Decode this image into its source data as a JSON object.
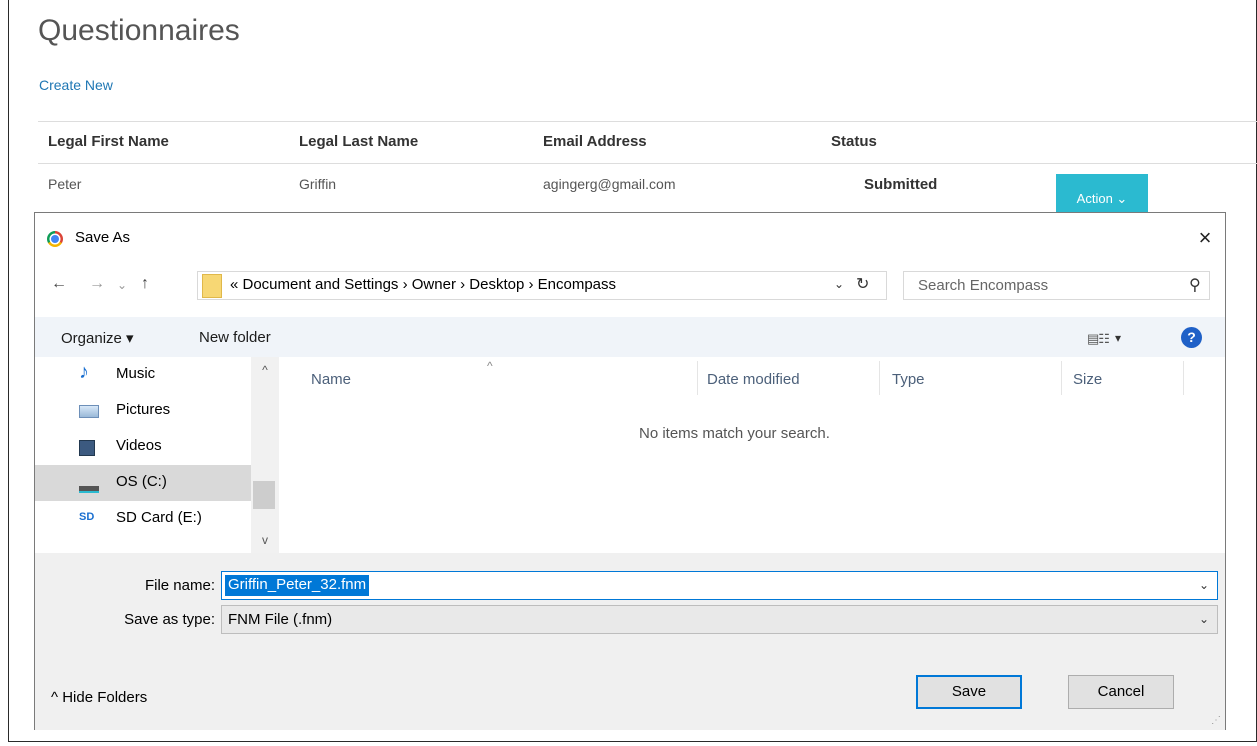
{
  "page": {
    "title": "Questionnaires",
    "create_link": "Create New",
    "table": {
      "headers": [
        "Legal First Name",
        "Legal Last Name",
        "Email Address",
        "Status"
      ],
      "rows": [
        {
          "first": "Peter",
          "last": "Griffin",
          "email": "agingerg@gmail.com",
          "status": "Submitted",
          "action": "Action ⌄"
        }
      ]
    }
  },
  "dialog": {
    "title": "Save As",
    "close_icon": "×",
    "nav": {
      "back": "←",
      "forward": "→",
      "recent": "⌄",
      "up": "↑"
    },
    "address": {
      "breadcrumb": "«  Document and Settings  ›  Owner  ›  Desktop  ›  Encompass",
      "dropdown": "⌄",
      "refresh": "↻"
    },
    "search": {
      "placeholder": "Search Encompass",
      "icon": "⚲"
    },
    "toolbar": {
      "organize": "Organize ▾",
      "new_folder": "New folder",
      "view_icon": "▤☷",
      "view_drop": "▾",
      "help": "?"
    },
    "nav_items": [
      {
        "label": "Music",
        "icon": "music-note-icon"
      },
      {
        "label": "Pictures",
        "icon": "pictures-icon"
      },
      {
        "label": "Videos",
        "icon": "videos-icon"
      },
      {
        "label": "OS (C:)",
        "icon": "drive-icon",
        "selected": true
      },
      {
        "label": "SD Card (E:)",
        "icon": "sd-card-icon"
      }
    ],
    "columns": [
      "Name",
      "Date modified",
      "Type",
      "Size"
    ],
    "empty_message": "No items match your search.",
    "file_name_label": "File name:",
    "file_name_value": "Griffin_Peter_32.fnm",
    "save_type_label": "Save as type:",
    "save_type_value": "FNM File (.fnm)",
    "hide_folders": "^  Hide Folders",
    "save_button": "Save",
    "cancel_button": "Cancel",
    "music_glyph": "♪",
    "sd_glyph": "SD"
  }
}
